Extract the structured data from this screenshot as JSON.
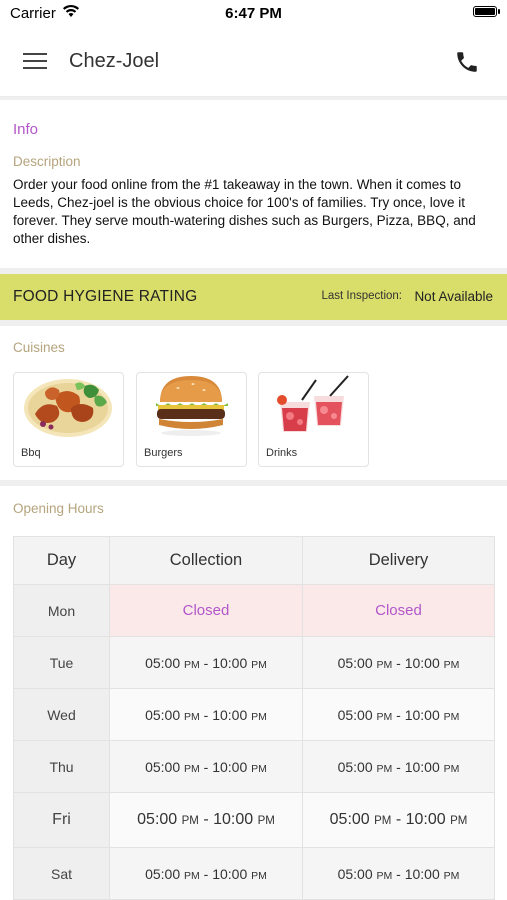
{
  "status_bar": {
    "carrier": "Carrier",
    "time": "6:47 PM"
  },
  "nav": {
    "title": "Chez-Joel",
    "menu_icon": "hamburger-menu-icon",
    "phone_icon": "phone-icon"
  },
  "info": {
    "heading": "Info",
    "description_label": "Description",
    "description": "Order your food online from the #1 takeaway in the town. When it comes to Leeds, Chez-joel is the obvious choice for 100's of families. Try once, love it forever. They serve mouth-watering dishes such as Burgers, Pizza, BBQ, and other dishes."
  },
  "hygiene": {
    "title": "FOOD HYGIENE RATING",
    "last_inspection_label": "Last Inspection:",
    "last_inspection_value": "Not Available",
    "bar_color": "#d9dd6a"
  },
  "cuisines": {
    "label": "Cuisines",
    "items": [
      {
        "name": "Bbq",
        "image": "bbq-chicken-wings-image"
      },
      {
        "name": "Burgers",
        "image": "burger-image"
      },
      {
        "name": "Drinks",
        "image": "red-drinks-image"
      }
    ]
  },
  "opening_hours": {
    "label": "Opening Hours",
    "columns": [
      "Day",
      "Collection",
      "Delivery"
    ],
    "rows": [
      {
        "day": "Mon",
        "collection": "Closed",
        "delivery": "Closed",
        "closed": true
      },
      {
        "day": "Tue",
        "collection": {
          "open": "05:00",
          "open_period": "PM",
          "close": "10:00",
          "close_period": "PM"
        },
        "delivery": {
          "open": "05:00",
          "open_period": "PM",
          "close": "10:00",
          "close_period": "PM"
        }
      },
      {
        "day": "Wed",
        "collection": {
          "open": "05:00",
          "open_period": "PM",
          "close": "10:00",
          "close_period": "PM"
        },
        "delivery": {
          "open": "05:00",
          "open_period": "PM",
          "close": "10:00",
          "close_period": "PM"
        }
      },
      {
        "day": "Thu",
        "collection": {
          "open": "05:00",
          "open_period": "PM",
          "close": "10:00",
          "close_period": "PM"
        },
        "delivery": {
          "open": "05:00",
          "open_period": "PM",
          "close": "10:00",
          "close_period": "PM"
        }
      },
      {
        "day": "Fri",
        "collection": {
          "open": "05:00",
          "open_period": "PM",
          "close": "10:00",
          "close_period": "PM"
        },
        "delivery": {
          "open": "05:00",
          "open_period": "PM",
          "close": "10:00",
          "close_period": "PM"
        },
        "current": true
      },
      {
        "day": "Sat",
        "collection": {
          "open": "05:00",
          "open_period": "PM",
          "close": "10:00",
          "close_period": "PM"
        },
        "delivery": {
          "open": "05:00",
          "open_period": "PM",
          "close": "10:00",
          "close_period": "PM"
        }
      }
    ]
  },
  "colors": {
    "accent": "#b356c9",
    "label": "#b5a47d",
    "closed_bg": "#fbe9ea"
  }
}
